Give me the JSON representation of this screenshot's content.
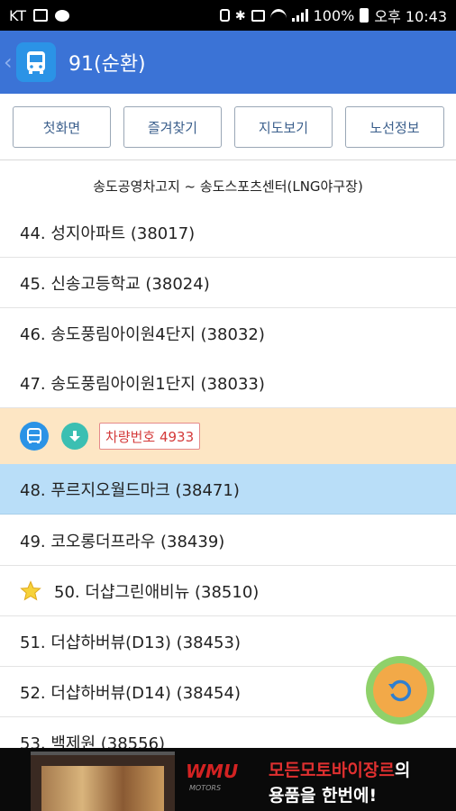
{
  "status_bar": {
    "carrier": "KT",
    "battery": "100%",
    "time": "오후 10:43",
    "icons": [
      "image-icon",
      "chat-icon",
      "lock-icon",
      "bluetooth-icon",
      "nfc-icon",
      "wifi-icon",
      "signal-icon",
      "battery-icon"
    ]
  },
  "app_bar": {
    "title": "91(순환)",
    "color": "#3b73d6"
  },
  "toolbar": {
    "home_label": "첫화면",
    "favorites_label": "즐겨찾기",
    "map_label": "지도보기",
    "route_info_label": "노선정보"
  },
  "route": {
    "header": "송도공영차고지 ~ 송도스포츠센터(LNG야구장)"
  },
  "stops_before": [
    {
      "label": "44. 성지아파트 (38017)"
    },
    {
      "label": "45. 신송고등학교 (38024)"
    },
    {
      "label": "46. 송도풍림아이원4단지 (38032)"
    },
    {
      "label": "47. 송도풍림아이원1단지 (38033)"
    }
  ],
  "vehicle": {
    "plate": "차량번호 4933"
  },
  "stops_after": [
    {
      "label": "48. 푸르지오월드마크 (38471)",
      "highlight": true
    },
    {
      "label": "49. 코오롱더프라우 (38439)"
    },
    {
      "label": "50. 더샵그린애비뉴 (38510)",
      "favorite": true
    },
    {
      "label": "51. 더샵하버뷰(D13) (38453)"
    },
    {
      "label": "52. 더샵하버뷰(D14) (38454)"
    },
    {
      "label": "53. 백제원 (38556)"
    }
  ],
  "ad": {
    "brand": "WMU",
    "brand_sub": "MOTORS",
    "line1_red": "모든모토바이장르",
    "line1_white": "의",
    "line2": "용품을 한번에!"
  }
}
